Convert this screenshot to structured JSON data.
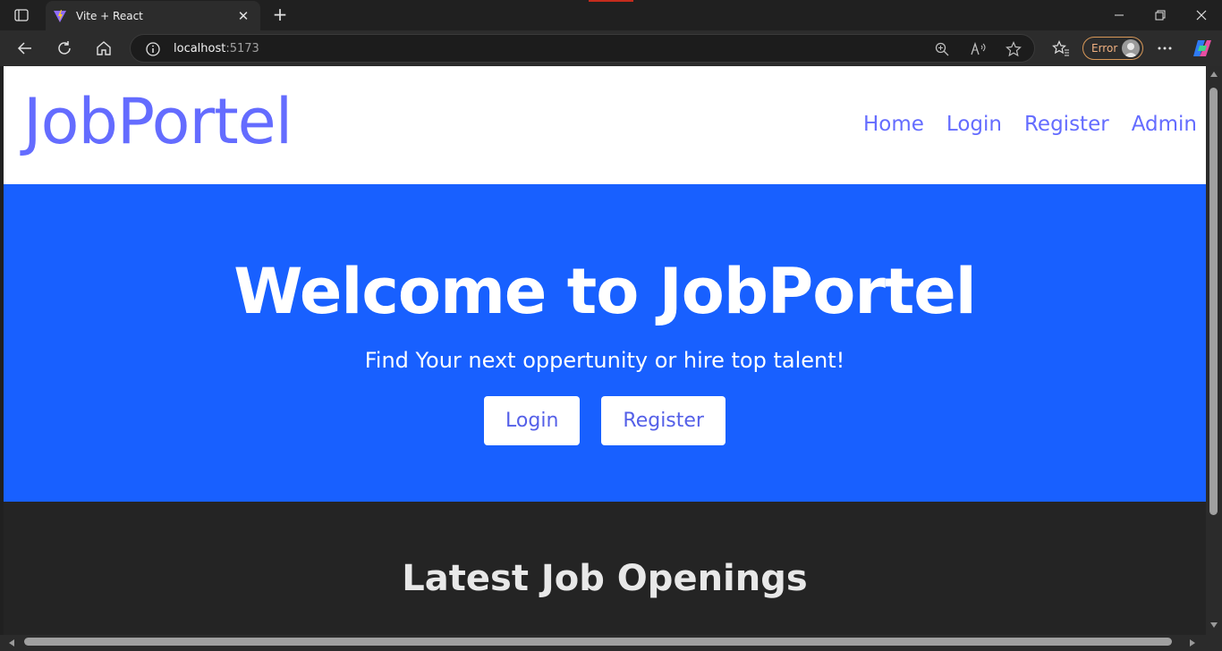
{
  "browser": {
    "tab": {
      "title": "Vite + React",
      "favicon": "vite-logo-icon",
      "close_icon": "close-icon"
    },
    "address_bar": {
      "host": "localhost",
      "port": ":5173"
    },
    "profile_status": "Error",
    "icons": {
      "tab_actions": "tab-actions-icon",
      "new_tab": "plus-icon",
      "back": "back-arrow-icon",
      "refresh": "refresh-icon",
      "home": "home-icon",
      "site_info": "info-icon",
      "zoom": "zoom-icon",
      "read_aloud": "read-aloud-icon",
      "favorite": "star-icon",
      "favorites_list": "favorites-icon",
      "more": "more-icon",
      "copilot": "copilot-icon"
    }
  },
  "header": {
    "logo": "JobPortel",
    "nav": [
      "Home",
      "Login",
      "Register",
      "Admin"
    ]
  },
  "hero": {
    "title": "Welcome to JobPortel",
    "subtitle": "Find Your next oppertunity or hire top talent!",
    "buttons": [
      "Login",
      "Register"
    ]
  },
  "section": {
    "openings_title": "Latest Job Openings"
  },
  "colors": {
    "brand": "#646cff",
    "hero_bg": "#1860ff",
    "page_bg": "#242424"
  }
}
